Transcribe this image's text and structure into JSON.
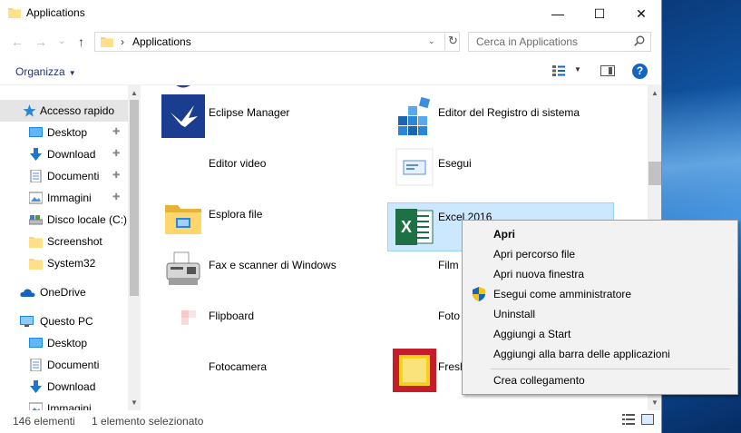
{
  "window": {
    "title": "Applications",
    "controls": {
      "minimize": "—",
      "maximize": "☐",
      "close": "✕"
    }
  },
  "nav": {
    "back": "←",
    "forward": "→",
    "recent": "⌄",
    "up": "↑"
  },
  "address": {
    "separator": "›",
    "path": "Applications",
    "dropdown": "⌄",
    "refresh": "↻"
  },
  "search": {
    "placeholder": "Cerca in Applications"
  },
  "toolbar": {
    "organize": "Organizza",
    "organize_caret": "▼",
    "view_caret": "▼",
    "help": "?"
  },
  "sidebar": {
    "items": [
      {
        "label": "Accesso rapido",
        "icon": "star-icon",
        "pinned": false
      },
      {
        "label": "Desktop",
        "icon": "desktop-icon",
        "pinned": true
      },
      {
        "label": "Download",
        "icon": "download-icon",
        "pinned": true
      },
      {
        "label": "Documenti",
        "icon": "document-icon",
        "pinned": true
      },
      {
        "label": "Immagini",
        "icon": "image-icon",
        "pinned": true
      },
      {
        "label": "Disco locale (C:)",
        "icon": "drive-icon",
        "pinned": false
      },
      {
        "label": "Screenshot",
        "icon": "folder-icon",
        "pinned": false
      },
      {
        "label": "System32",
        "icon": "folder-icon",
        "pinned": false
      },
      {
        "label": "OneDrive",
        "icon": "cloud-icon",
        "pinned": false
      },
      {
        "label": "Questo PC",
        "icon": "pc-icon",
        "pinned": false
      },
      {
        "label": "Desktop",
        "icon": "desktop-icon",
        "pinned": false
      },
      {
        "label": "Documenti",
        "icon": "document-icon",
        "pinned": false
      },
      {
        "label": "Download",
        "icon": "download-icon",
        "pinned": false
      },
      {
        "label": "Immagini",
        "icon": "image-icon",
        "pinned": false
      }
    ],
    "pin_glyph": "📌"
  },
  "files": [
    {
      "label": "Eclipse Manager",
      "icon": "eclipse-manager-icon"
    },
    {
      "label": "Editor del Registro di sistema",
      "icon": "registry-editor-icon"
    },
    {
      "label": "Editor video",
      "icon": "blank-icon"
    },
    {
      "label": "Esegui",
      "icon": "run-icon"
    },
    {
      "label": "Esplora file",
      "icon": "file-explorer-icon"
    },
    {
      "label": "Excel 2016",
      "icon": "excel-icon",
      "selected": true
    },
    {
      "label": "Fax e scanner di Windows",
      "icon": "fax-icon"
    },
    {
      "label": "Film",
      "icon": "blank-icon"
    },
    {
      "label": "Flipboard",
      "icon": "flipboard-icon"
    },
    {
      "label": "Foto",
      "icon": "blank-icon"
    },
    {
      "label": "Fotocamera",
      "icon": "blank-icon"
    },
    {
      "label": "Fresh",
      "icon": "fresh-paint-icon"
    }
  ],
  "status": {
    "count": "146 elementi",
    "selection": "1 elemento selezionato"
  },
  "context_menu": {
    "items": [
      {
        "label": "Apri",
        "bold": true
      },
      {
        "label": "Apri percorso file"
      },
      {
        "label": "Apri nuova finestra"
      },
      {
        "label": "Esegui come amministratore",
        "icon": "uac-shield-icon"
      },
      {
        "label": "Uninstall"
      },
      {
        "label": "Aggiungi a Start"
      },
      {
        "label": "Aggiungi alla barra delle applicazioni"
      },
      {
        "label": "Crea collegamento"
      }
    ]
  },
  "colors": {
    "accent": "#1e3287",
    "selection_bg": "#cce8ff",
    "selection_border": "#99d1ff",
    "excel_green": "#1e7145"
  }
}
